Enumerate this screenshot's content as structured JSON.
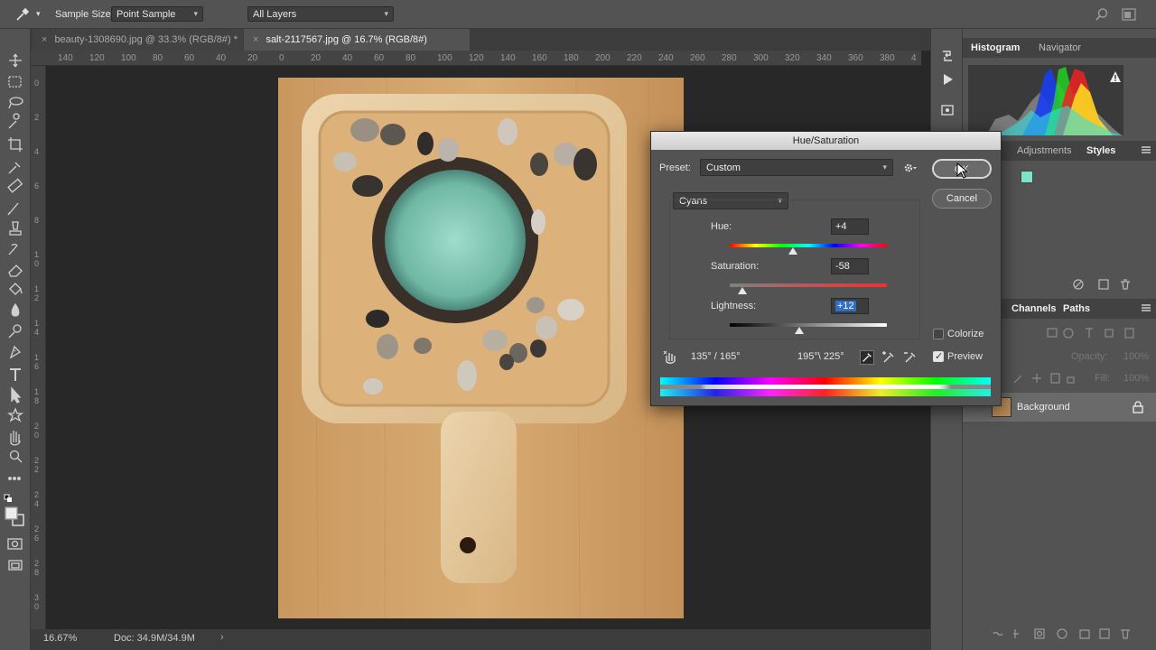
{
  "options_bar": {
    "sample_size_label": "Sample Size:",
    "sample_size_value": "Point Sample",
    "layers_value": "All Layers"
  },
  "tabs": [
    {
      "label": "beauty-1308690.jpg @ 33.3% (RGB/8#) *",
      "close": "×"
    },
    {
      "label": "salt-2117567.jpg @ 16.7% (RGB/8#)",
      "close": "×"
    }
  ],
  "ruler": {
    "h_ticks": [
      "140",
      "120",
      "100",
      "80",
      "60",
      "40",
      "20",
      "0",
      "20",
      "40",
      "60",
      "80",
      "100",
      "120",
      "140",
      "160",
      "180",
      "200",
      "220",
      "240",
      "260",
      "280",
      "300",
      "320",
      "340",
      "360",
      "380",
      "4"
    ],
    "v_ticks": [
      "0",
      "2",
      "4",
      "6",
      "8",
      "1 0",
      "1 2",
      "1 4",
      "1 6",
      "1 8",
      "2 0",
      "2 2",
      "2 4",
      "2 6",
      "2 8",
      "3 0"
    ]
  },
  "status": {
    "zoom": "16.67%",
    "doc": "Doc: 34.9M/34.9M",
    "arrow": "›"
  },
  "panels": {
    "top_tabs": [
      "Histogram",
      "Navigator"
    ],
    "mid_tabs": [
      "s",
      "Adjustments",
      "Styles"
    ],
    "layer_tabs": [
      "Channels",
      "Paths"
    ],
    "opacity_label": "Opacity:",
    "opacity_value": "100%",
    "fill_label": "Fill:",
    "fill_value": "100%",
    "layer_name": "Background",
    "swatch_color": "#7de3c9"
  },
  "dialog": {
    "title": "Hue/Saturation",
    "preset_label": "Preset:",
    "preset_value": "Custom",
    "channel_value": "Cyans",
    "hue_label": "Hue:",
    "hue_value": "+4",
    "saturation_label": "Saturation:",
    "saturation_value": "-58",
    "lightness_label": "Lightness:",
    "lightness_value": "+12",
    "ok_label": "OK",
    "cancel_label": "Cancel",
    "colorize_label": "Colorize",
    "preview_label": "Preview",
    "range_left": "135° / 165°",
    "range_right": "195°\\ 225°",
    "colorize_checked": false,
    "preview_checked": true
  }
}
